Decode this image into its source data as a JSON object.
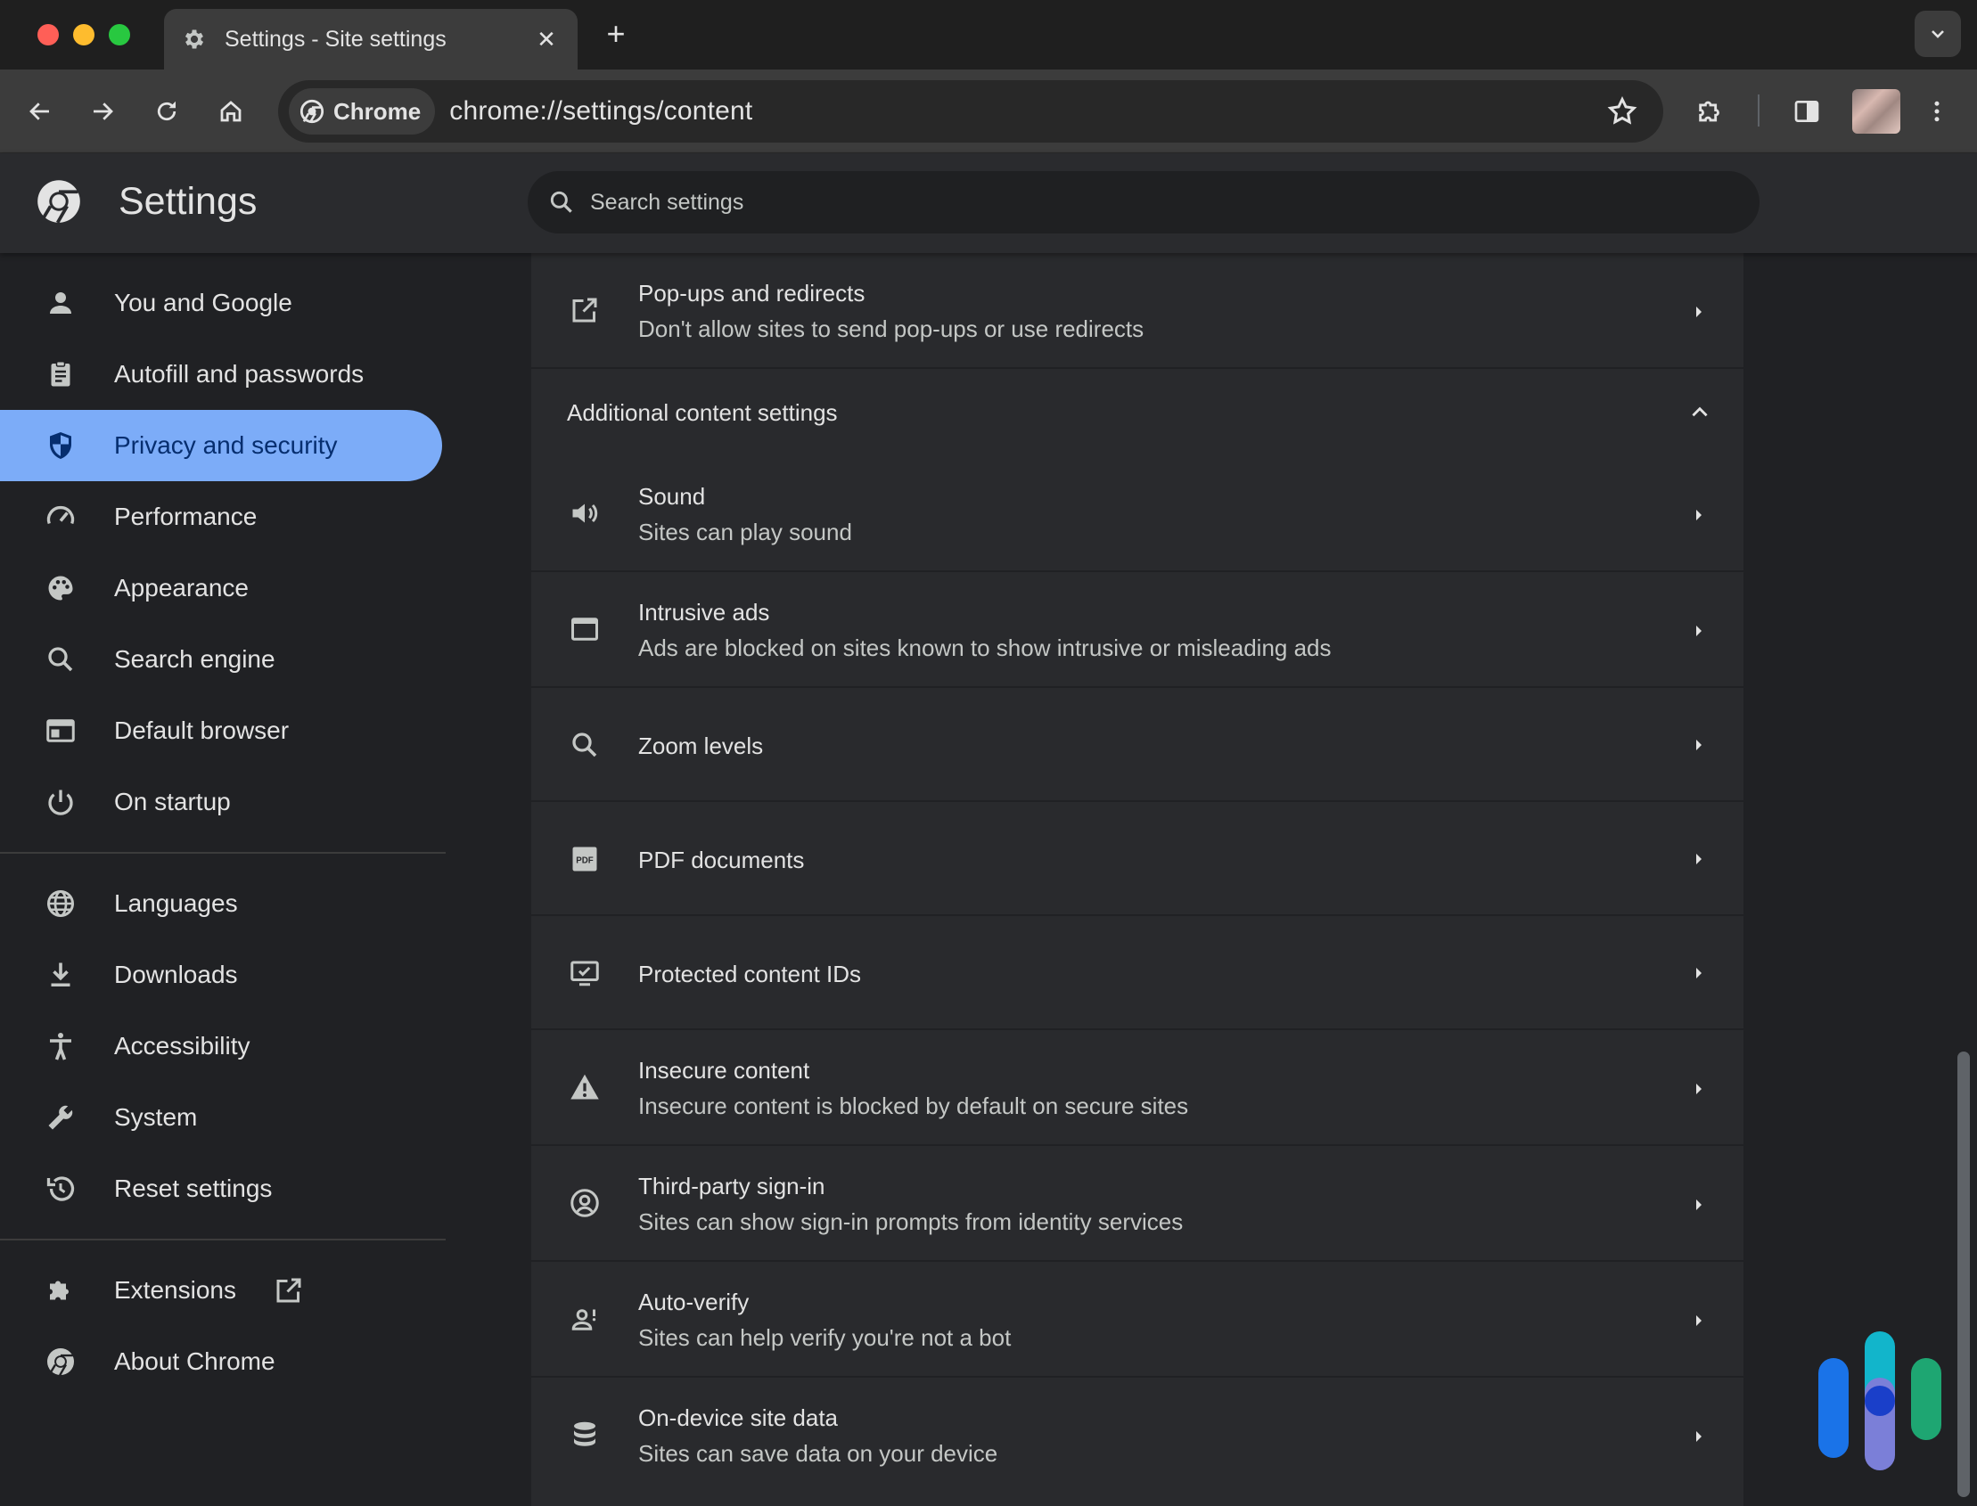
{
  "window": {
    "tab_title": "Settings - Site settings",
    "tab_close": "✕",
    "new_tab": "+"
  },
  "toolbar": {
    "chip_label": "Chrome",
    "url": "chrome://settings/content"
  },
  "settings": {
    "title": "Settings",
    "search_placeholder": "Search settings"
  },
  "sidebar": {
    "items": [
      {
        "label": "You and Google",
        "icon": "person-icon"
      },
      {
        "label": "Autofill and passwords",
        "icon": "clipboard-icon"
      },
      {
        "label": "Privacy and security",
        "icon": "shield-icon",
        "active": true
      },
      {
        "label": "Performance",
        "icon": "speedometer-icon"
      },
      {
        "label": "Appearance",
        "icon": "palette-icon"
      },
      {
        "label": "Search engine",
        "icon": "search-icon"
      },
      {
        "label": "Default browser",
        "icon": "browser-window-icon"
      },
      {
        "label": "On startup",
        "icon": "power-icon"
      },
      {
        "label": "Languages",
        "icon": "globe-icon"
      },
      {
        "label": "Downloads",
        "icon": "download-icon"
      },
      {
        "label": "Accessibility",
        "icon": "accessibility-icon"
      },
      {
        "label": "System",
        "icon": "wrench-icon"
      },
      {
        "label": "Reset settings",
        "icon": "history-icon"
      },
      {
        "label": "Extensions",
        "icon": "puzzle-icon"
      },
      {
        "label": "About Chrome",
        "icon": "chrome-logo-icon"
      }
    ]
  },
  "content": {
    "popups": {
      "title": "Pop-ups and redirects",
      "subtitle": "Don't allow sites to send pop-ups or use redirects"
    },
    "additional_title": "Additional content settings",
    "rows": [
      {
        "title": "Sound",
        "subtitle": "Sites can play sound",
        "icon": "speaker-icon"
      },
      {
        "title": "Intrusive ads",
        "subtitle": "Ads are blocked on sites known to show intrusive or misleading ads",
        "icon": "window-icon"
      },
      {
        "title": "Zoom levels",
        "subtitle": "",
        "icon": "magnifier-icon"
      },
      {
        "title": "PDF documents",
        "subtitle": "",
        "icon": "pdf-icon"
      },
      {
        "title": "Protected content IDs",
        "subtitle": "",
        "icon": "monitor-check-icon"
      },
      {
        "title": "Insecure content",
        "subtitle": "Insecure content is blocked by default on secure sites",
        "icon": "warning-icon"
      },
      {
        "title": "Third-party sign-in",
        "subtitle": "Sites can show sign-in prompts from identity services",
        "icon": "account-circle-icon"
      },
      {
        "title": "Auto-verify",
        "subtitle": "Sites can help verify you're not a bot",
        "icon": "person-alert-icon"
      },
      {
        "title": "On-device site data",
        "subtitle": "Sites can save data on your device",
        "icon": "database-icon"
      }
    ]
  },
  "colors": {
    "active_nav_bg": "#7cacf8",
    "active_nav_text": "#062e6f",
    "background": "#202124",
    "card": "#292a2d"
  }
}
